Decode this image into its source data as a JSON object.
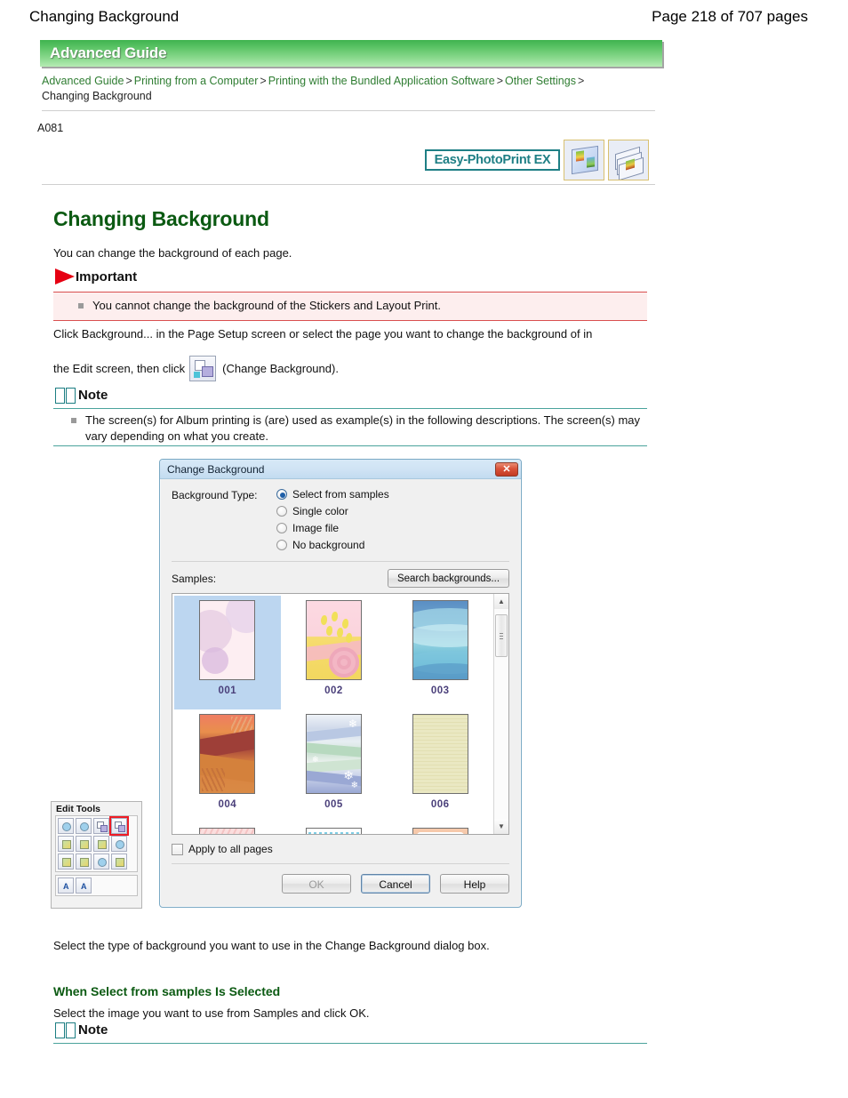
{
  "page": {
    "doc_title": "Changing Background",
    "page_count": "Page 218 of 707 pages",
    "doc_code": "A081"
  },
  "banner": {
    "label": "Advanced Guide"
  },
  "breadcrumb": {
    "items": [
      "Advanced Guide",
      "Printing from a Computer",
      "Printing with the Bundled Application Software",
      "Other Settings"
    ],
    "separator": ">",
    "current": "Changing Background"
  },
  "badge": {
    "product": "Easy-PhotoPrint EX"
  },
  "content": {
    "h1": "Changing Background",
    "intro": "You can change the background of each page.",
    "important": {
      "label": "Important",
      "items": [
        "You cannot change the background of the Stickers and Layout Print."
      ]
    },
    "click_para_part1": "Click Background... in the Page Setup screen or select the page you want to change the background of in",
    "click_para_part2": "the Edit screen, then click",
    "click_para_part3": "(Change Background).",
    "note1": {
      "label": "Note",
      "items": [
        "The screen(s) for Album printing is (are) used as example(s) in the following descriptions. The screen(s) may vary depending on what you create."
      ]
    },
    "select_type_para": "Select the type of background you want to use in the Change Background dialog box.",
    "h3_when_selected": "When Select from samples Is Selected",
    "select_image_para": "Select the image you want to use from Samples and click OK.",
    "note2": {
      "label": "Note"
    }
  },
  "edit_tools": {
    "title": "Edit Tools",
    "selected_tool": "change-background-tool"
  },
  "dialog": {
    "title": "Change Background",
    "close_label": "✕",
    "background_type_label": "Background Type:",
    "radio_options": [
      {
        "label": "Select from samples",
        "selected": true
      },
      {
        "label": "Single color",
        "selected": false
      },
      {
        "label": "Image file",
        "selected": false
      },
      {
        "label": "No background",
        "selected": false
      }
    ],
    "samples_label": "Samples:",
    "search_backgrounds_label": "Search backgrounds...",
    "samples": [
      {
        "caption": "001",
        "selected": true
      },
      {
        "caption": "002",
        "selected": false
      },
      {
        "caption": "003",
        "selected": false
      },
      {
        "caption": "004",
        "selected": false
      },
      {
        "caption": "005",
        "selected": false
      },
      {
        "caption": "006",
        "selected": false
      }
    ],
    "apply_to_all_label": "Apply to all pages",
    "apply_to_all_checked": false,
    "buttons": {
      "ok": "OK",
      "cancel": "Cancel",
      "help": "Help"
    }
  },
  "colors": {
    "banner_green_dark": "#3fb34f",
    "banner_green_light": "#b6ecb4",
    "link_green": "#2f7d32",
    "heading_green": "#0b5a12",
    "important_red": "#e60012",
    "important_bg": "#fdeeee",
    "note_teal": "#1b7d82",
    "badge_teal": "#1e7f85",
    "selection_blue": "#bcd6f0"
  }
}
